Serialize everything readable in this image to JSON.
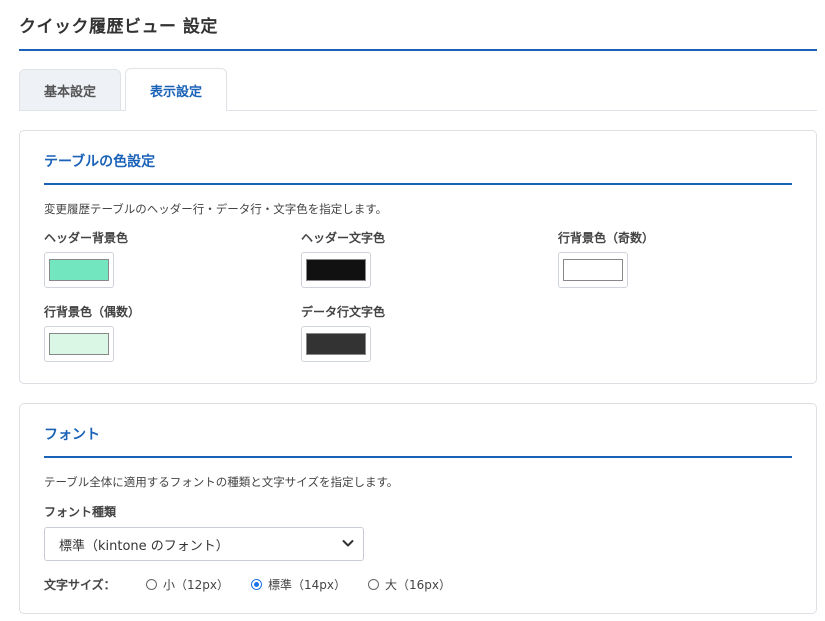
{
  "page": {
    "title": "クイック履歴ビュー 設定"
  },
  "tabs": [
    {
      "label": "基本設定",
      "active": false
    },
    {
      "label": "表示設定",
      "active": true
    }
  ],
  "table_colors": {
    "heading": "テーブルの色設定",
    "description": "変更履歴テーブルのヘッダー行・データ行・文字色を指定します。",
    "fields": [
      {
        "label": "ヘッダー背景色",
        "color": "#72e6bf"
      },
      {
        "label": "ヘッダー文字色",
        "color": "#111111"
      },
      {
        "label": "行背景色（奇数）",
        "color": "#ffffff"
      },
      {
        "label": "行背景色（偶数）",
        "color": "#d9f7e4"
      },
      {
        "label": "データ行文字色",
        "color": "#333333"
      }
    ]
  },
  "font": {
    "heading": "フォント",
    "description": "テーブル全体に適用するフォントの種類と文字サイズを指定します。",
    "family_label": "フォント種類",
    "family_value": "標準（kintone のフォント）",
    "size_label": "文字サイズ：",
    "size_options": [
      {
        "label": "小（12px）",
        "checked": false
      },
      {
        "label": "標準（14px）",
        "checked": true
      },
      {
        "label": "大（16px）",
        "checked": false
      }
    ]
  },
  "colors": {
    "accent": "#1a62b8",
    "radio_accent": "#1a73e8"
  },
  "icons": {
    "select_chevron": "chevron-down-icon"
  }
}
